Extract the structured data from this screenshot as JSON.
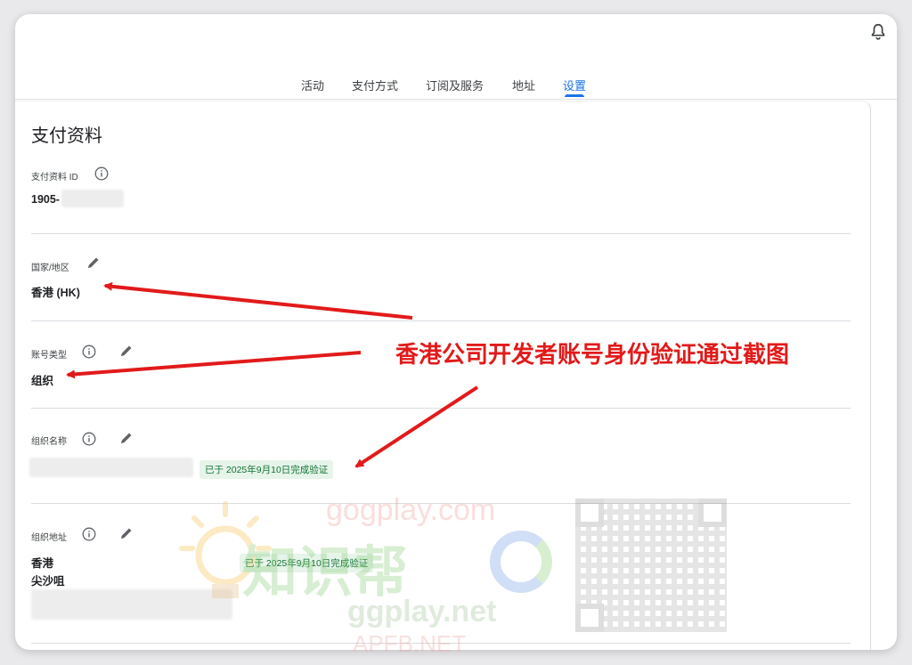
{
  "header": {
    "bell_icon": "bell-icon"
  },
  "tabs": [
    {
      "label": "活动"
    },
    {
      "label": "支付方式"
    },
    {
      "label": "订阅及服务"
    },
    {
      "label": "地址"
    },
    {
      "label": "设置",
      "active": true
    }
  ],
  "card": {
    "title": "支付资料",
    "profile_id": {
      "label": "支付资料 ID",
      "value": "1905-"
    },
    "country": {
      "label": "国家/地区",
      "value": "香港 (HK)"
    },
    "account_type": {
      "label": "账号类型",
      "value": "组织"
    },
    "org_name": {
      "label": "组织名称",
      "verified": "已于 2025年9月10日完成验证"
    },
    "org_address": {
      "label": "组织地址",
      "line1": "香港",
      "line2": "尖沙咀",
      "verified": "已于 2025年9月10日完成验证"
    }
  },
  "annotation": {
    "text": "香港公司开发者账号身份验证通过截图",
    "color": "#e21a1a"
  },
  "watermark": {
    "line1": "gogplay.com",
    "line2": "知识帮",
    "line3": "ggplay.net",
    "line4": "APFB.NET"
  },
  "colors": {
    "accent": "#1a73e8",
    "verified_bg": "#e6f4ea",
    "verified_text": "#137333",
    "arrow": "#e21a1a"
  }
}
